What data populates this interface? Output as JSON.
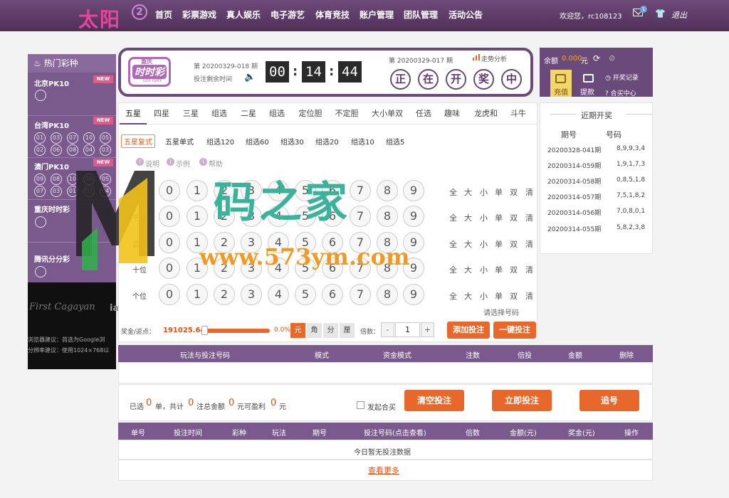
{
  "header": {
    "logo": "太阳",
    "logo_badge": "2",
    "nav": [
      "首页",
      "彩票游戏",
      "真人娱乐",
      "电子游艺",
      "体育竞技",
      "账户管理",
      "团队管理",
      "活动公告"
    ],
    "welcome": "欢迎您，rc108123",
    "mail_count": "1",
    "logout": "退出"
  },
  "sidebar": {
    "title": "热门彩种",
    "badge": "NEW",
    "items": [
      {
        "name": "北京PK10",
        "new": true
      },
      {
        "name": "台湾PK10",
        "new": true,
        "balls": [
          "01",
          "03",
          "07",
          "10",
          "05",
          "02",
          "06",
          "08",
          "04",
          "03"
        ]
      },
      {
        "name": "澳门PK10",
        "new": true,
        "balls": [
          "09",
          "08",
          "10",
          "06",
          "05",
          "07",
          "03",
          "01",
          "02",
          "04"
        ]
      },
      {
        "name": "重庆时时彩",
        "new": false
      },
      {
        "name": "腾讯分分彩",
        "new": false
      }
    ],
    "banner_logo": "First Cagayan",
    "banner_tail": "ia",
    "notes": [
      "浏览器建议：首选为Google浏",
      "分辨率建议：使用1024×768以"
    ]
  },
  "lottery": {
    "logo_top": "重庆",
    "logo_main": "时时彩",
    "logo_sub": "LOTTERY",
    "current_issue": "第 20200329-018 期",
    "remain_label": "投注剩余时间",
    "timer": [
      "00",
      "14",
      "44"
    ],
    "prev_issue": "第 20200329-017 期",
    "trend": "走势分析",
    "draw_status": [
      "正",
      "在",
      "开",
      "奖",
      "中"
    ]
  },
  "account": {
    "balance_label": "余额",
    "balance": "0.000",
    "balance_unit": "元",
    "deposit": "充值",
    "withdraw": "提款",
    "history": "开奖记录",
    "center": "合买中心"
  },
  "play": {
    "tabs": [
      "五星",
      "四星",
      "三星",
      "组选",
      "二星",
      "组选",
      "定位胆",
      "不定胆",
      "大小单双",
      "任选",
      "趣味",
      "龙虎和",
      "斗牛"
    ],
    "subtabs": [
      "五星复式",
      "五星单式",
      "组选120",
      "组选60",
      "组选30",
      "组选20",
      "组选10",
      "组选5"
    ],
    "help_links": [
      "说明",
      "示例",
      "帮助"
    ],
    "positions": [
      "万位",
      "千位",
      "百位",
      "十位",
      "个位"
    ],
    "digits": [
      "0",
      "1",
      "2",
      "3",
      "4",
      "5",
      "6",
      "7",
      "8",
      "9"
    ],
    "quick": [
      "全",
      "大",
      "小",
      "单",
      "双",
      "清"
    ],
    "choose_hint": "请选择号码",
    "rebate_label": "奖金/返点：",
    "rebate_value": "191025.64",
    "rebate_pct": "0.0%",
    "slider_fraction": 0,
    "units": [
      "元",
      "角",
      "分",
      "厘"
    ],
    "multiplier_label": "倍数：",
    "multiplier": "1",
    "minus": "-",
    "plus": "+",
    "add_bet": "添加投注",
    "quick_bet": "一键投注"
  },
  "recent": {
    "title": "近期开奖",
    "col_issue": "期号",
    "col_code": "号码",
    "rows": [
      {
        "issue": "20200328-041期",
        "code": "8,9,9,3,4"
      },
      {
        "issue": "20200314-059期",
        "code": "1,9,1,7,3"
      },
      {
        "issue": "20200314-058期",
        "code": "0,8,5,1,8"
      },
      {
        "issue": "20200314-057期",
        "code": "7,5,1,8,2"
      },
      {
        "issue": "20200314-056期",
        "code": "7,0,8,0,1"
      },
      {
        "issue": "20200314-055期",
        "code": "5,8,2,3,8"
      }
    ]
  },
  "bet_table": {
    "headers": [
      "玩法与投注号码",
      "模式",
      "资金模式",
      "注数",
      "倍投",
      "金额",
      "删除"
    ]
  },
  "summary": {
    "t1": "已选",
    "n1": "0",
    "t2": "单，共计",
    "n2": "0",
    "t3": "注总金额",
    "n3": "0",
    "t4": "元可盈利",
    "n4": "0",
    "t5": "元",
    "joint": "发起合买",
    "clear": "清空投注",
    "submit": "立即投注",
    "chase": "追号"
  },
  "today": {
    "headers": [
      "单号",
      "投注时间",
      "彩种",
      "玩法",
      "期号",
      "投注号码(点击查看)",
      "倍数",
      "金额(元)",
      "奖金(元)",
      "操作"
    ],
    "empty": "今日暂无投注数据",
    "view_more": "查看更多"
  },
  "watermark": {
    "text": "码之家",
    "url": "www.573ym.com"
  }
}
